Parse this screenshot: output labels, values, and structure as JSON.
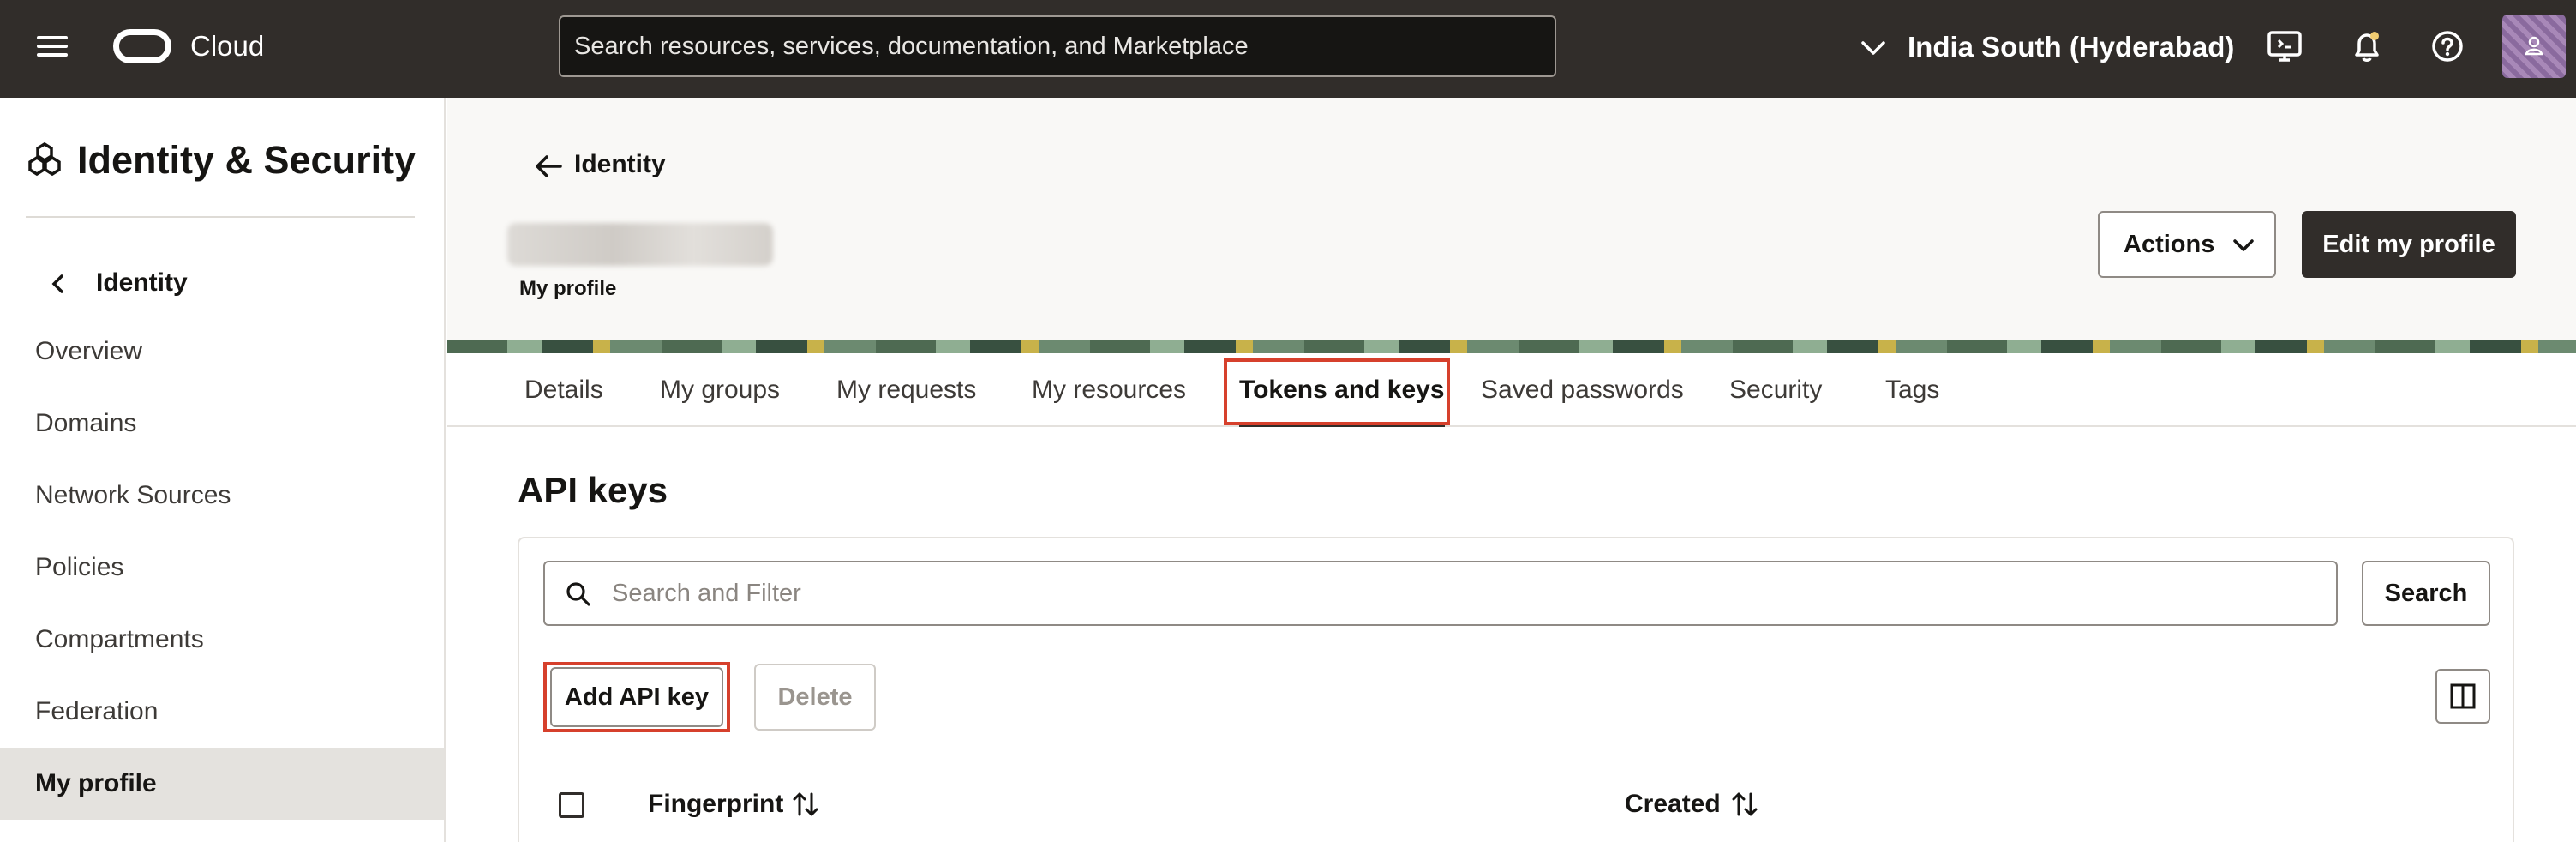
{
  "topbar": {
    "brand": "Cloud",
    "search_placeholder": "Search resources, services, documentation, and Marketplace",
    "region": "India South (Hyderabad)",
    "icons": [
      "menu-icon",
      "oracle-logo",
      "chevron-down-icon",
      "cloud-shell-icon",
      "bell-icon",
      "help-icon",
      "avatar"
    ]
  },
  "sidebar": {
    "title": "Identity & Security",
    "back_label": "Identity",
    "items": [
      {
        "label": "Overview"
      },
      {
        "label": "Domains"
      },
      {
        "label": "Network Sources"
      },
      {
        "label": "Policies"
      },
      {
        "label": "Compartments"
      },
      {
        "label": "Federation"
      },
      {
        "label": "My profile",
        "active": true
      }
    ]
  },
  "header": {
    "back_label": "Identity",
    "subtitle": "My profile",
    "actions_label": "Actions",
    "edit_label": "Edit my profile"
  },
  "tabs": [
    {
      "label": "Details"
    },
    {
      "label": "My groups"
    },
    {
      "label": "My requests"
    },
    {
      "label": "My resources"
    },
    {
      "label": "Tokens and keys",
      "active": true
    },
    {
      "label": "Saved passwords"
    },
    {
      "label": "Security"
    },
    {
      "label": "Tags"
    }
  ],
  "section": {
    "title": "API keys",
    "filter_placeholder": "Search and Filter",
    "search_label": "Search",
    "add_label": "Add API key",
    "delete_label": "Delete",
    "columns": [
      "Fingerprint",
      "Created"
    ]
  },
  "colors": {
    "topbar": "#312d2a",
    "highlight": "#d6402c",
    "active_nav": "#e4e2de"
  }
}
